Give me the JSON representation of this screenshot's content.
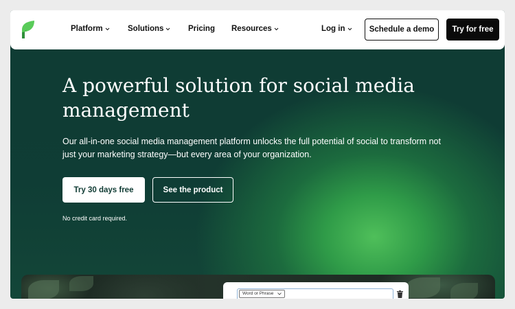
{
  "brand": {
    "logo_icon": "sprout-leaf-icon",
    "accent_color": "#59cb59",
    "dark_green": "#0f3b33"
  },
  "nav": {
    "items": [
      {
        "label": "Platform",
        "has_dropdown": true
      },
      {
        "label": "Solutions",
        "has_dropdown": true
      },
      {
        "label": "Pricing",
        "has_dropdown": false
      },
      {
        "label": "Resources",
        "has_dropdown": true
      }
    ],
    "login": {
      "label": "Log in",
      "has_dropdown": true
    },
    "schedule_demo": "Schedule a demo",
    "try_free": "Try for free"
  },
  "hero": {
    "title": "A powerful solution for social media management",
    "subtitle": "Our all-in-one social media management platform unlocks the full potential of social to transform not just your marketing strategy—but every area of your organization.",
    "primary_cta": "Try 30 days free",
    "secondary_cta": "See the product",
    "note": "No credit card required."
  },
  "preview": {
    "select_value": "Word or Phrase",
    "delete_icon": "trash-icon"
  }
}
